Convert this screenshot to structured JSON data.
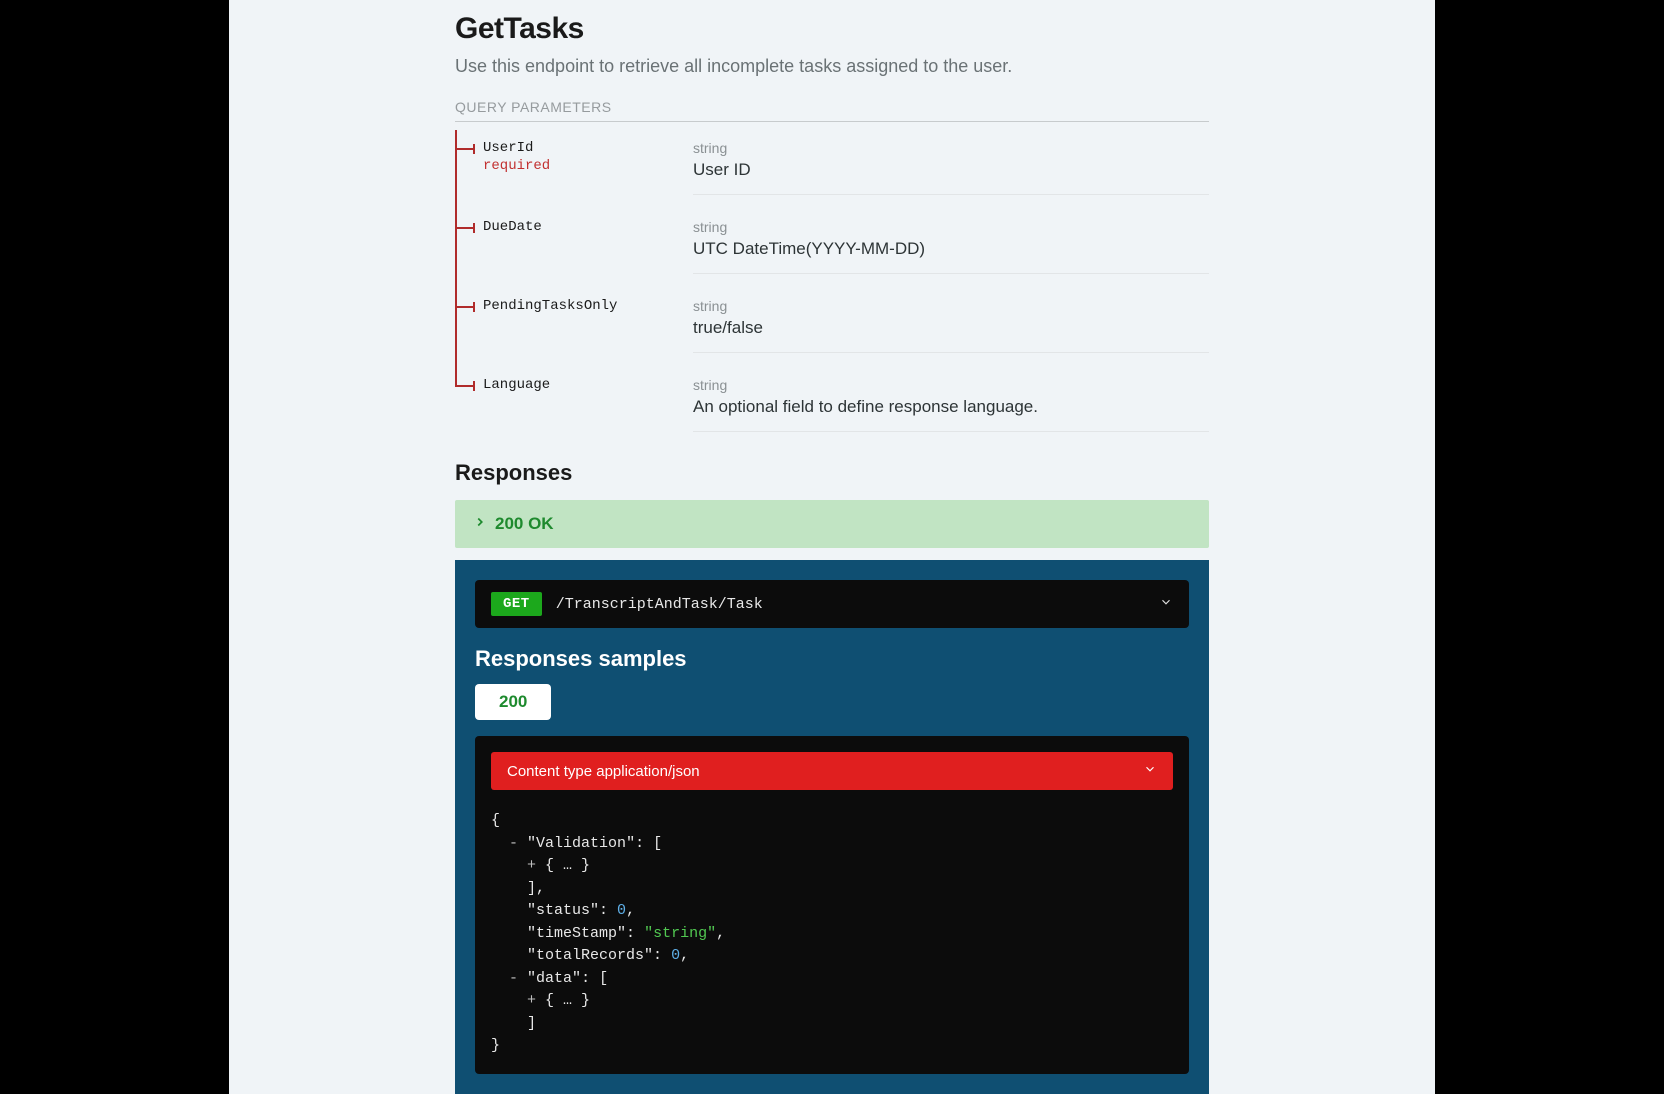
{
  "endpoint": {
    "title": "GetTasks",
    "description": "Use this endpoint to retrieve all incomplete tasks assigned to the user.",
    "method": "GET",
    "path": "/TranscriptAndTask/Task"
  },
  "query_params_label": "QUERY PARAMETERS",
  "params": [
    {
      "name": "UserId",
      "required": "required",
      "type": "string",
      "desc": "User ID"
    },
    {
      "name": "DueDate",
      "required": "",
      "type": "string",
      "desc": "UTC DateTime(YYYY-MM-DD)"
    },
    {
      "name": "PendingTasksOnly",
      "required": "",
      "type": "string",
      "desc": "true/false"
    },
    {
      "name": "Language",
      "required": "",
      "type": "string",
      "desc": "An optional field to define response language."
    }
  ],
  "responses_heading": "Responses",
  "response_status": "200 OK",
  "sample": {
    "heading": "Responses samples",
    "tab": "200",
    "content_type_label": "Content type application/json",
    "json": {
      "l0": "{",
      "l1_t": "-",
      "l1_k": "\"Validation\"",
      "l1_r": ": [",
      "l2_t": "+",
      "l2_r": " { … }",
      "l3": "],",
      "l4_k": "\"status\"",
      "l4_c": ": ",
      "l4_v": "0",
      "l4_e": ",",
      "l5_k": "\"timeStamp\"",
      "l5_c": ": ",
      "l5_v": "\"string\"",
      "l5_e": ",",
      "l6_k": "\"totalRecords\"",
      "l6_c": ": ",
      "l6_v": "0",
      "l6_e": ",",
      "l7_t": "-",
      "l7_k": "\"data\"",
      "l7_r": ": [",
      "l8_t": "+",
      "l8_r": " { … }",
      "l9": "]",
      "l10": "}"
    }
  }
}
